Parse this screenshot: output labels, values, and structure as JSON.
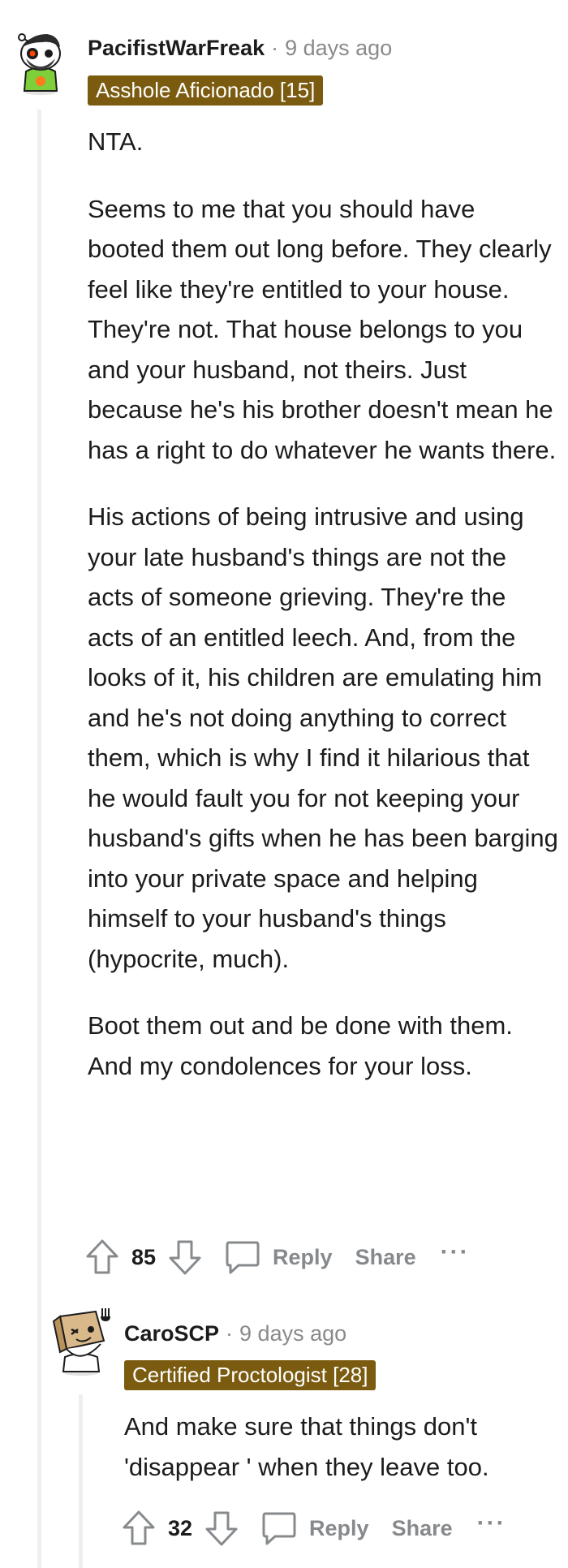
{
  "comments": [
    {
      "username": "PacifistWarFreak",
      "separator": "·",
      "time": "9 days ago",
      "flair": "Asshole Aficionado [15]",
      "paragraphs": [
        "NTA.",
        "Seems to me that you should have booted them out long before. They clearly feel like they're entitled to your house. They're not. That house belongs to you and your husband, not theirs. Just because he's his brother doesn't mean he has a right to do whatever he wants there.",
        "His actions of being intrusive and using your late husband's things are not the acts of someone grieving. They're the acts of an entitled leech. And, from the looks of it, his children are emulating him and he's not doing anything to correct them, which is why I find it hilarious that he would fault you for not keeping your husband's gifts when he has been barging into your private space and helping himself to your husband's things (hypocrite, much).",
        "Boot them out and be done with them. And my condolences for your loss."
      ],
      "votes": "85",
      "reply_label": "Reply",
      "share_label": "Share",
      "more_label": "···",
      "avatar_icon": "snoo-avatar-icon"
    },
    {
      "username": "CaroSCP",
      "separator": "·",
      "time": "9 days ago",
      "flair": "Certified Proctologist [28]",
      "paragraphs": [
        "And make sure that things don't 'disappear ' when they leave too."
      ],
      "votes": "32",
      "reply_label": "Reply",
      "share_label": "Share",
      "more_label": "···",
      "avatar_icon": "box-snoo-avatar-icon"
    }
  ],
  "colors": {
    "flair_bg": "#7a5b0f",
    "meta_gray": "#8a8a8a",
    "action_gray": "#878a8c",
    "thread_line": "#edeff1"
  }
}
